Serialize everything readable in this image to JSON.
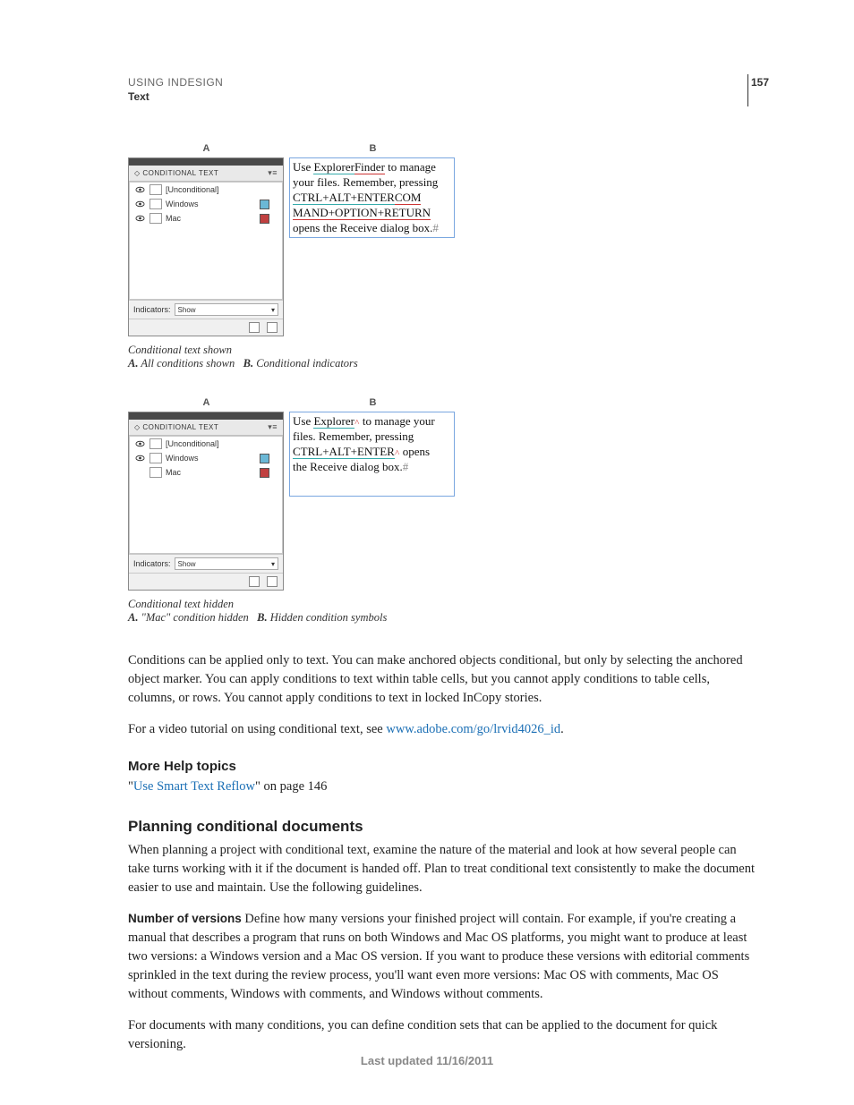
{
  "header": {
    "doc_title": "USING INDESIGN",
    "section": "Text",
    "page_number": "157"
  },
  "figure1": {
    "label_a": "A",
    "label_b": "B",
    "panel": {
      "title": "◇ CONDITIONAL TEXT",
      "rows": [
        {
          "name": "[Unconditional]",
          "eye": true,
          "swatch": null
        },
        {
          "name": "Windows",
          "eye": true,
          "swatch": "#6bb8d6"
        },
        {
          "name": "Mac",
          "eye": true,
          "swatch": "#c04040"
        }
      ],
      "indicators_label": "Indicators:",
      "indicators_value": "Show"
    },
    "frame_text": {
      "l1a": "Use ",
      "l1b": "Explorer",
      "l1c": "Finder",
      "l1d": " to manage",
      "l2": "your files. Remember, pressing",
      "l3a": "CTRL+ALT+ENTER",
      "l3b": "COM",
      "l4": "MAND+OPTION+RETURN",
      "l5a": "opens the Receive dialog box.",
      "l5b": "#"
    },
    "caption_title": "Conditional text shown",
    "caption_a_label": "A.",
    "caption_a_text": "All conditions shown",
    "caption_b_label": "B.",
    "caption_b_text": "Conditional indicators"
  },
  "figure2": {
    "label_a": "A",
    "label_b": "B",
    "panel": {
      "title": "◇ CONDITIONAL TEXT",
      "rows": [
        {
          "name": "[Unconditional]",
          "eye": true,
          "swatch": null
        },
        {
          "name": "Windows",
          "eye": true,
          "swatch": "#6bb8d6"
        },
        {
          "name": "Mac",
          "eye": false,
          "swatch": "#c04040"
        }
      ],
      "indicators_label": "Indicators:",
      "indicators_value": "Show"
    },
    "frame_text": {
      "l1a": "Use ",
      "l1b": "Explorer",
      "l1c": " to manage your",
      "l2": "files. Remember, pressing",
      "l3a": "CTRL+ALT+ENTER",
      "l3b": " opens",
      "l4a": "the Receive dialog box.",
      "l4b": "#"
    },
    "caption_title": "Conditional text hidden",
    "caption_a_label": "A.",
    "caption_a_text": "\"Mac\" condition hidden",
    "caption_b_label": "B.",
    "caption_b_text": "Hidden condition symbols"
  },
  "body": {
    "p1": "Conditions can be applied only to text. You can make anchored objects conditional, but only by selecting the anchored object marker. You can apply conditions to text within table cells, but you cannot apply conditions to table cells, columns, or rows. You cannot apply conditions to text in locked InCopy stories.",
    "p2_a": "For a video tutorial on using conditional text, see ",
    "p2_link": "www.adobe.com/go/lrvid4026_id",
    "p2_b": "."
  },
  "help": {
    "heading": "More Help topics",
    "quote_open": "\"",
    "link_text": "Use Smart Text Reflow",
    "quote_close_rest": "\" on page 146"
  },
  "planning": {
    "heading": "Planning conditional documents",
    "p1": "When planning a project with conditional text, examine the nature of the material and look at how several people can take turns working with it if the document is handed off. Plan to treat conditional text consistently to make the document easier to use and maintain. Use the following guidelines.",
    "runin": "Number of versions",
    "p2": "  Define how many versions your finished project will contain. For example, if you're creating a manual that describes a program that runs on both Windows and Mac OS platforms, you might want to produce at least two versions: a Windows version and a Mac OS version. If you want to produce these versions with editorial comments sprinkled in the text during the review process, you'll want even more versions: Mac OS with comments, Mac OS without comments, Windows with comments, and Windows without comments.",
    "p3": "For documents with many conditions, you can define condition sets that can be applied to the document for quick versioning."
  },
  "footer": {
    "text": "Last updated 11/16/2011"
  }
}
